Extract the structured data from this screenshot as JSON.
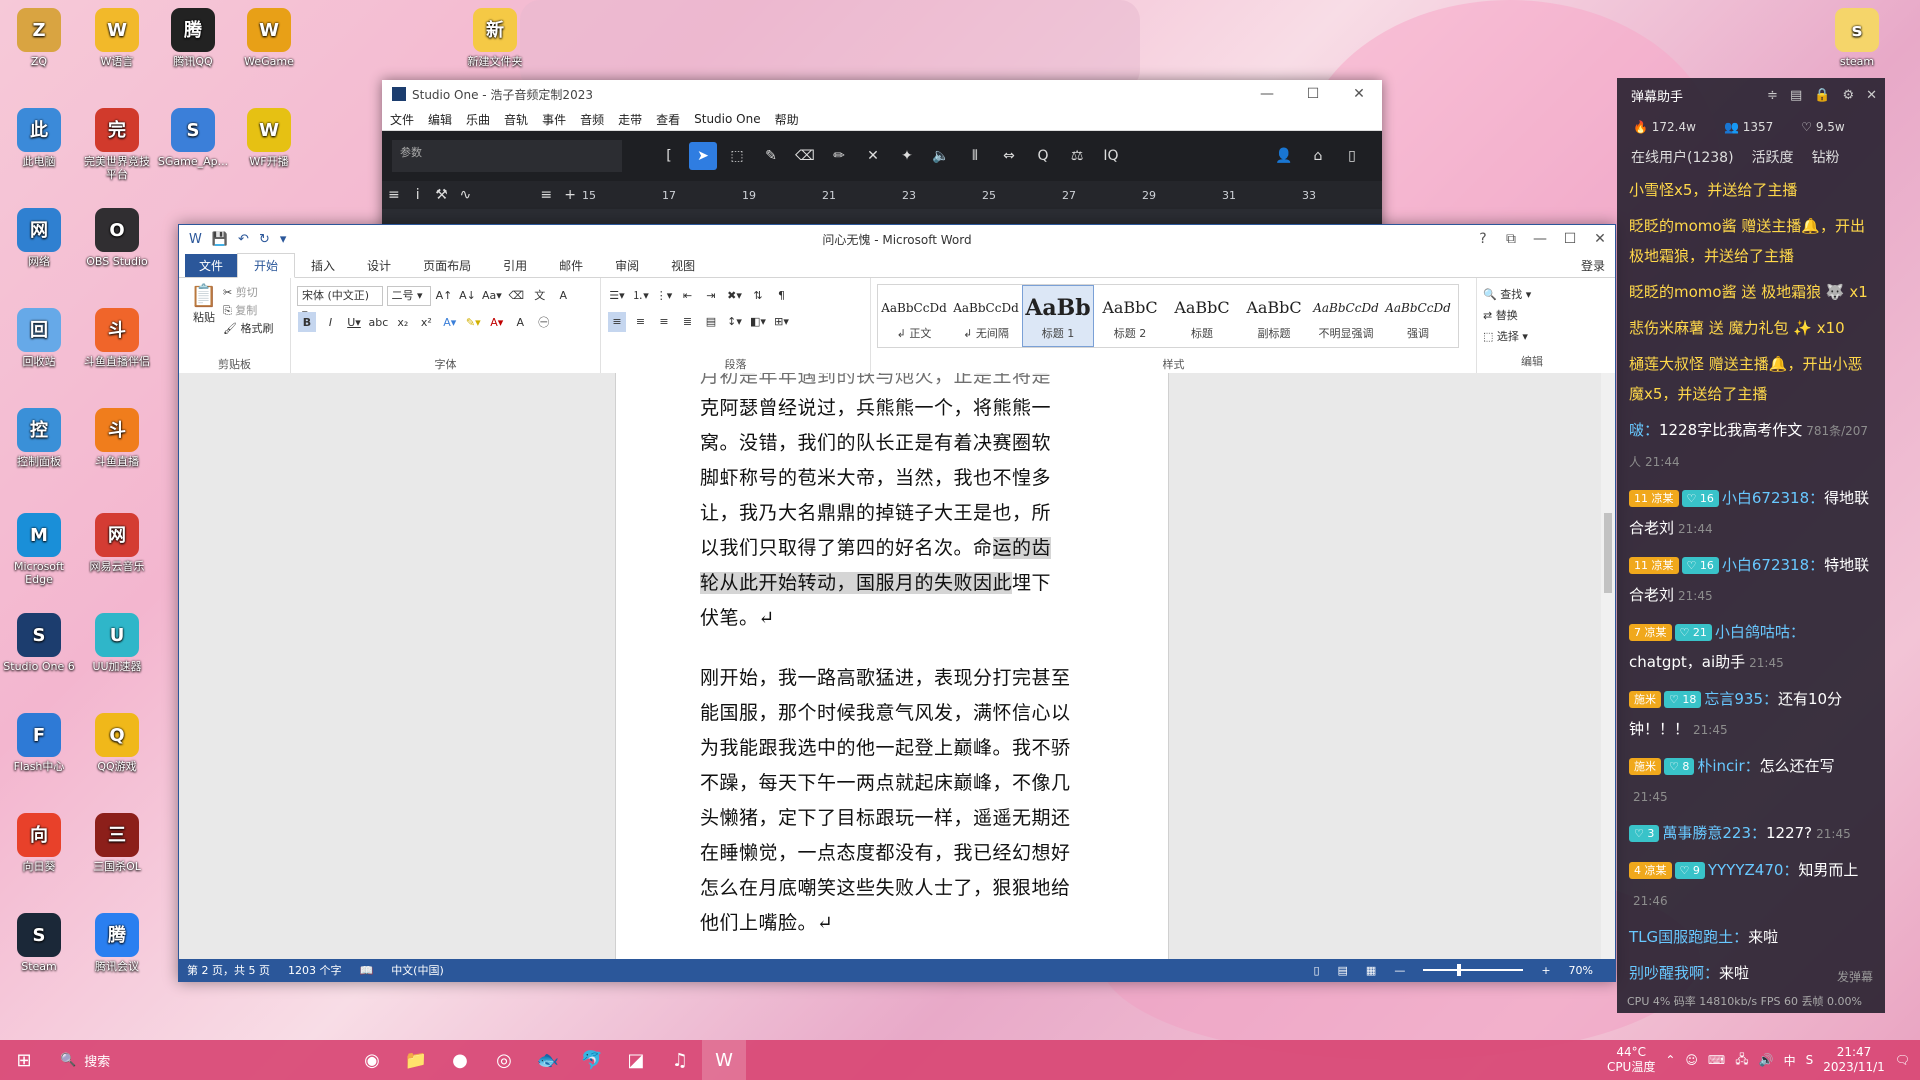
{
  "desktop": {
    "icons": [
      {
        "label": "ZQ",
        "icon": "user-folder-icon",
        "color": "#d9a441"
      },
      {
        "label": "W语言",
        "icon": "owl-app-icon",
        "color": "#f2b92a"
      },
      {
        "label": "腾讯QQ",
        "icon": "qq-penguin-icon",
        "color": "#222222"
      },
      {
        "label": "WeGame",
        "icon": "wegame-icon",
        "color": "#e8a017"
      },
      {
        "label": "新建文件夹",
        "icon": "folder-icon",
        "color": "#f5c945"
      },
      {
        "label": "此电脑",
        "icon": "computer-icon",
        "color": "#3b8ad9"
      },
      {
        "label": "完美世界竞技平台",
        "icon": "perfect-world-icon",
        "color": "#d13a2c"
      },
      {
        "label": "SGame_Ap...",
        "icon": "ipa-file-icon",
        "color": "#3b7fd9"
      },
      {
        "label": "WF开播",
        "icon": "wf-live-icon",
        "color": "#e6c113"
      },
      {
        "label": "网络",
        "icon": "network-icon",
        "color": "#2f80d1"
      },
      {
        "label": "OBS Studio",
        "icon": "obs-icon",
        "color": "#302e31"
      },
      {
        "label": "回收站",
        "icon": "recycle-bin-icon",
        "color": "#66a9e8"
      },
      {
        "label": "斗鱼直播伴侣",
        "icon": "douyu-companion-icon",
        "color": "#f0652a"
      },
      {
        "label": "控制面板",
        "icon": "control-panel-icon",
        "color": "#3a90d8"
      },
      {
        "label": "斗鱼直播",
        "icon": "douyu-icon",
        "color": "#f07d1c"
      },
      {
        "label": "Microsoft Edge",
        "icon": "edge-icon",
        "color": "#1a8fd8"
      },
      {
        "label": "网易云音乐",
        "icon": "netease-music-icon",
        "color": "#d43c33"
      },
      {
        "label": "Studio One 6",
        "icon": "studio-one-icon",
        "color": "#1c3d6e"
      },
      {
        "label": "UU加速器",
        "icon": "uu-accelerator-icon",
        "color": "#2fb6c9"
      },
      {
        "label": "Flash中心",
        "icon": "flash-icon",
        "color": "#2e7ad6"
      },
      {
        "label": "QQ游戏",
        "icon": "qq-game-icon",
        "color": "#f0b81a"
      },
      {
        "label": "向日葵",
        "icon": "sunflower-remote-icon",
        "color": "#e8412a"
      },
      {
        "label": "三国杀OL",
        "icon": "sanguosha-icon",
        "color": "#8c1f1a"
      },
      {
        "label": "Steam",
        "icon": "steam-icon",
        "color": "#1b2838"
      },
      {
        "label": "腾讯会议",
        "icon": "tencent-meeting-icon",
        "color": "#2a7ff0"
      },
      {
        "label": "steam",
        "icon": "steam-file-icon",
        "color": "#f5d56a"
      }
    ]
  },
  "studio_one": {
    "title": "Studio One - 浩子音频定制2023",
    "menu": [
      "文件",
      "编辑",
      "乐曲",
      "音轨",
      "事件",
      "音频",
      "走带",
      "查看",
      "Studio One",
      "帮助"
    ],
    "param_label": "参数",
    "ruler": [
      "15",
      "17",
      "19",
      "21",
      "23",
      "25",
      "27",
      "29",
      "31",
      "33"
    ]
  },
  "word": {
    "title": "问心无愧 - Microsoft Word",
    "help": "?",
    "login": "登录",
    "tabs": [
      "文件",
      "开始",
      "插入",
      "设计",
      "页面布局",
      "引用",
      "邮件",
      "审阅",
      "视图"
    ],
    "clipboard": {
      "paste": "粘贴",
      "cut": "剪切",
      "copy": "复制",
      "format_painter": "格式刷",
      "label": "剪贴板"
    },
    "font": {
      "name": "宋体 (中文正)",
      "size": "二号",
      "label": "字体"
    },
    "paragraph_label": "段落",
    "styles": {
      "label": "样式",
      "items": [
        {
          "sample": "AaBbCcDd",
          "name": "↲ 正文"
        },
        {
          "sample": "AaBbCcDd",
          "name": "↲ 无间隔"
        },
        {
          "sample": "AaBb",
          "name": "标题 1"
        },
        {
          "sample": "AaBbC",
          "name": "标题 2"
        },
        {
          "sample": "AaBbC",
          "name": "标题"
        },
        {
          "sample": "AaBbC",
          "name": "副标题"
        },
        {
          "sample": "AaBbCcDd",
          "name": "不明显强调"
        },
        {
          "sample": "AaBbCcDd",
          "name": "强调"
        }
      ]
    },
    "editing": {
      "find": "查找",
      "replace": "替换",
      "select": "选择",
      "label": "编辑"
    },
    "doc": {
      "para1_top": "月初是年年遇到的铁与炮火，正是王将是",
      "para1_lines": [
        "克阿瑟曾经说过，兵熊熊一个，将熊熊一",
        "窝。没错，我们的队长正是有着决赛圈软",
        "脚虾称号的苞米大帝，当然，我也不惶多",
        "让，我乃大名鼎鼎的掉链子大王是也，所",
        "以我们只取得了第四的好名次。命运的齿",
        "轮从此开始转动，国服月的失败因此埋下",
        "伏笔。↵"
      ],
      "para2_lines": [
        "刚开始，我一路高歌猛进，表现分打完甚至",
        "能国服，那个时候我意气风发，满怀信心以",
        "为我能跟我选中的他一起登上巅峰。我不骄",
        "不躁，每天下午一两点就起床巅峰，不像几",
        "头懒猪，定下了目标跟玩一样，遥遥无期还",
        "在睡懒觉，一点态度都没有，我已经幻想好",
        "怎么在月底嘲笑这些失败人士了，狠狠地给",
        "他们上嘴脸。↵"
      ]
    },
    "status": {
      "page": "第 2 页，共 5 页",
      "words": "1203 个字",
      "lang": "中文(中国)",
      "zoom": "70%"
    }
  },
  "chat": {
    "title": "弹幕助手",
    "stats": [
      "172.4w",
      "1357",
      "9.5w"
    ],
    "tabs": [
      "在线用户(1238)",
      "活跃度",
      "钻粉"
    ],
    "messages": [
      {
        "kind": "gift",
        "text": "小雪怪x5，并送给了主播"
      },
      {
        "kind": "gift",
        "text": "眨眨的momo酱 赠送主播🔔，开出极地霜狼，并送给了主播"
      },
      {
        "kind": "gift",
        "text": "眨眨的momo酱 送 极地霜狼 🐺 x1"
      },
      {
        "kind": "gift",
        "text": "悲伤米麻薯 送 魔力礼包 ✨ x10"
      },
      {
        "kind": "gift",
        "text": "樋莲大叔怪 赠送主播🔔，开出小恶魔x5，并送给了主播"
      },
      {
        "kind": "chat",
        "user": "啵",
        "text": "1228字比我高考作文",
        "note": "781条/207人",
        "time": "21:44"
      },
      {
        "kind": "chat",
        "badges": [
          "11 凉某",
          "♡ 16"
        ],
        "user": "小白672318",
        "text": "得地联合老刘",
        "time": "21:44"
      },
      {
        "kind": "chat",
        "badges": [
          "11 凉某",
          "♡ 16"
        ],
        "user": "小白672318",
        "text": "特地联合老刘",
        "time": "21:45"
      },
      {
        "kind": "chat",
        "badges": [
          "7 凉某",
          "♡ 21"
        ],
        "user": "小白鸽咕咕",
        "text": "chatgpt，ai助手",
        "time": "21:45"
      },
      {
        "kind": "chat",
        "badges": [
          "施米",
          "♡ 18"
        ],
        "user": "忘言935",
        "text": "还有10分钟！！！",
        "time": "21:45"
      },
      {
        "kind": "chat",
        "badges": [
          "施米",
          "♡ 8"
        ],
        "user": "朴incir",
        "text": "怎么还在写",
        "time": "21:45"
      },
      {
        "kind": "chat",
        "badges": [
          "♡ 3"
        ],
        "user": "萬事勝意223",
        "text": "1227?",
        "time": "21:45"
      },
      {
        "kind": "chat",
        "badges": [
          "4 凉某",
          "♡ 9"
        ],
        "user": "YYYYZ470",
        "text": "知男而上",
        "time": "21:46"
      },
      {
        "kind": "chat",
        "user": "TLG国服跑跑土",
        "text": "来啦",
        "time": ""
      },
      {
        "kind": "chat",
        "user": "别吵醒我啊",
        "text": "来啦",
        "time": ""
      }
    ],
    "send_label": "发弹幕",
    "footer": "CPU 4%  码率 14810kb/s  FPS 60  丢帧 0.00%"
  },
  "taskbar": {
    "search": "搜索",
    "temp": "44°C",
    "temp_label": "CPU温度",
    "ime": "中",
    "time": "21:47",
    "date": "2023/11/1"
  }
}
